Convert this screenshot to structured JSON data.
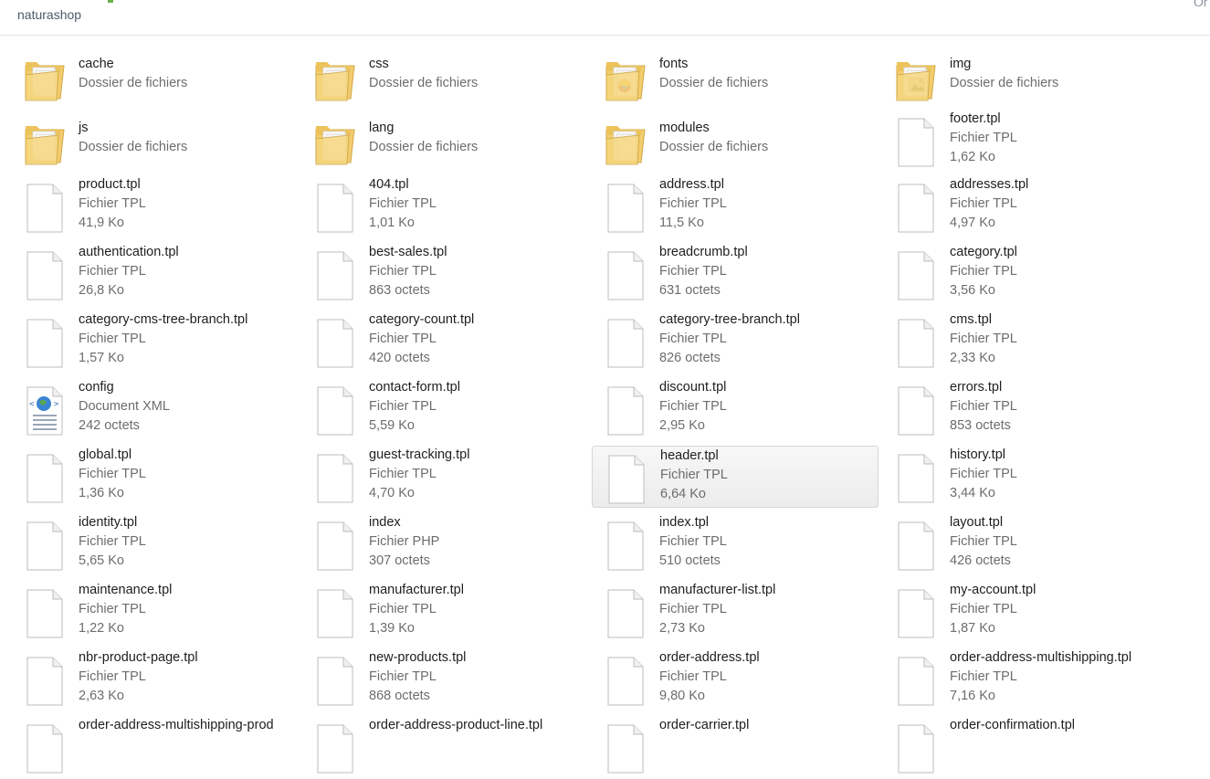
{
  "window": {
    "folder_name": "naturashop",
    "corner_text": "Or"
  },
  "items": [
    {
      "name": "cache",
      "type": "Dossier de fichiers",
      "size": "",
      "icon": "folder-icon",
      "kind": "folder"
    },
    {
      "name": "css",
      "type": "Dossier de fichiers",
      "size": "",
      "icon": "folder-icon",
      "kind": "folder"
    },
    {
      "name": "fonts",
      "type": "Dossier de fichiers",
      "size": "",
      "icon": "folder-chrome-icon",
      "kind": "folder"
    },
    {
      "name": "img",
      "type": "Dossier de fichiers",
      "size": "",
      "icon": "folder-images-icon",
      "kind": "folder"
    },
    {
      "name": "js",
      "type": "Dossier de fichiers",
      "size": "",
      "icon": "folder-icon",
      "kind": "folder"
    },
    {
      "name": "lang",
      "type": "Dossier de fichiers",
      "size": "",
      "icon": "folder-icon",
      "kind": "folder"
    },
    {
      "name": "modules",
      "type": "Dossier de fichiers",
      "size": "",
      "icon": "folder-icon",
      "kind": "folder"
    },
    {
      "name": "footer.tpl",
      "type": "Fichier TPL",
      "size": "1,62 Ko",
      "icon": "file-icon",
      "kind": "file"
    },
    {
      "name": "product.tpl",
      "type": "Fichier TPL",
      "size": "41,9 Ko",
      "icon": "file-icon",
      "kind": "file"
    },
    {
      "name": "404.tpl",
      "type": "Fichier TPL",
      "size": "1,01 Ko",
      "icon": "file-icon",
      "kind": "file"
    },
    {
      "name": "address.tpl",
      "type": "Fichier TPL",
      "size": "11,5 Ko",
      "icon": "file-icon",
      "kind": "file"
    },
    {
      "name": "addresses.tpl",
      "type": "Fichier TPL",
      "size": "4,97 Ko",
      "icon": "file-icon",
      "kind": "file"
    },
    {
      "name": "authentication.tpl",
      "type": "Fichier TPL",
      "size": "26,8 Ko",
      "icon": "file-icon",
      "kind": "file"
    },
    {
      "name": "best-sales.tpl",
      "type": "Fichier TPL",
      "size": "863 octets",
      "icon": "file-icon",
      "kind": "file"
    },
    {
      "name": "breadcrumb.tpl",
      "type": "Fichier TPL",
      "size": "631 octets",
      "icon": "file-icon",
      "kind": "file"
    },
    {
      "name": "category.tpl",
      "type": "Fichier TPL",
      "size": "3,56 Ko",
      "icon": "file-icon",
      "kind": "file"
    },
    {
      "name": "category-cms-tree-branch.tpl",
      "type": "Fichier TPL",
      "size": "1,57 Ko",
      "icon": "file-icon",
      "kind": "file"
    },
    {
      "name": "category-count.tpl",
      "type": "Fichier TPL",
      "size": "420 octets",
      "icon": "file-icon",
      "kind": "file"
    },
    {
      "name": "category-tree-branch.tpl",
      "type": "Fichier TPL",
      "size": "826 octets",
      "icon": "file-icon",
      "kind": "file"
    },
    {
      "name": "cms.tpl",
      "type": "Fichier TPL",
      "size": "2,33 Ko",
      "icon": "file-icon",
      "kind": "file"
    },
    {
      "name": "config",
      "type": "Document XML",
      "size": "242 octets",
      "icon": "xml-document-icon",
      "kind": "xml"
    },
    {
      "name": "contact-form.tpl",
      "type": "Fichier TPL",
      "size": "5,59 Ko",
      "icon": "file-icon",
      "kind": "file"
    },
    {
      "name": "discount.tpl",
      "type": "Fichier TPL",
      "size": "2,95 Ko",
      "icon": "file-icon",
      "kind": "file"
    },
    {
      "name": "errors.tpl",
      "type": "Fichier TPL",
      "size": "853 octets",
      "icon": "file-icon",
      "kind": "file"
    },
    {
      "name": "global.tpl",
      "type": "Fichier TPL",
      "size": "1,36 Ko",
      "icon": "file-icon",
      "kind": "file"
    },
    {
      "name": "guest-tracking.tpl",
      "type": "Fichier TPL",
      "size": "4,70 Ko",
      "icon": "file-icon",
      "kind": "file"
    },
    {
      "name": "header.tpl",
      "type": "Fichier TPL",
      "size": "6,64 Ko",
      "icon": "file-icon",
      "kind": "file",
      "selected": true
    },
    {
      "name": "history.tpl",
      "type": "Fichier TPL",
      "size": "3,44 Ko",
      "icon": "file-icon",
      "kind": "file"
    },
    {
      "name": "identity.tpl",
      "type": "Fichier TPL",
      "size": "5,65 Ko",
      "icon": "file-icon",
      "kind": "file"
    },
    {
      "name": "index",
      "type": "Fichier PHP",
      "size": "307 octets",
      "icon": "file-icon",
      "kind": "file"
    },
    {
      "name": "index.tpl",
      "type": "Fichier TPL",
      "size": "510 octets",
      "icon": "file-icon",
      "kind": "file"
    },
    {
      "name": "layout.tpl",
      "type": "Fichier TPL",
      "size": "426 octets",
      "icon": "file-icon",
      "kind": "file"
    },
    {
      "name": "maintenance.tpl",
      "type": "Fichier TPL",
      "size": "1,22 Ko",
      "icon": "file-icon",
      "kind": "file"
    },
    {
      "name": "manufacturer.tpl",
      "type": "Fichier TPL",
      "size": "1,39 Ko",
      "icon": "file-icon",
      "kind": "file"
    },
    {
      "name": "manufacturer-list.tpl",
      "type": "Fichier TPL",
      "size": "2,73 Ko",
      "icon": "file-icon",
      "kind": "file"
    },
    {
      "name": "my-account.tpl",
      "type": "Fichier TPL",
      "size": "1,87 Ko",
      "icon": "file-icon",
      "kind": "file"
    },
    {
      "name": "nbr-product-page.tpl",
      "type": "Fichier TPL",
      "size": "2,63 Ko",
      "icon": "file-icon",
      "kind": "file"
    },
    {
      "name": "new-products.tpl",
      "type": "Fichier TPL",
      "size": "868 octets",
      "icon": "file-icon",
      "kind": "file"
    },
    {
      "name": "order-address.tpl",
      "type": "Fichier TPL",
      "size": "9,80 Ko",
      "icon": "file-icon",
      "kind": "file"
    },
    {
      "name": "order-address-multishipping.tpl",
      "type": "Fichier TPL",
      "size": "7,16 Ko",
      "icon": "file-icon",
      "kind": "file"
    },
    {
      "name": "order-address-multishipping-prod",
      "type": "",
      "size": "",
      "icon": "file-icon",
      "kind": "file"
    },
    {
      "name": "order-address-product-line.tpl",
      "type": "",
      "size": "",
      "icon": "file-icon",
      "kind": "file"
    },
    {
      "name": "order-carrier.tpl",
      "type": "",
      "size": "",
      "icon": "file-icon",
      "kind": "file"
    },
    {
      "name": "order-confirmation.tpl",
      "type": "",
      "size": "",
      "icon": "file-icon",
      "kind": "file"
    }
  ]
}
